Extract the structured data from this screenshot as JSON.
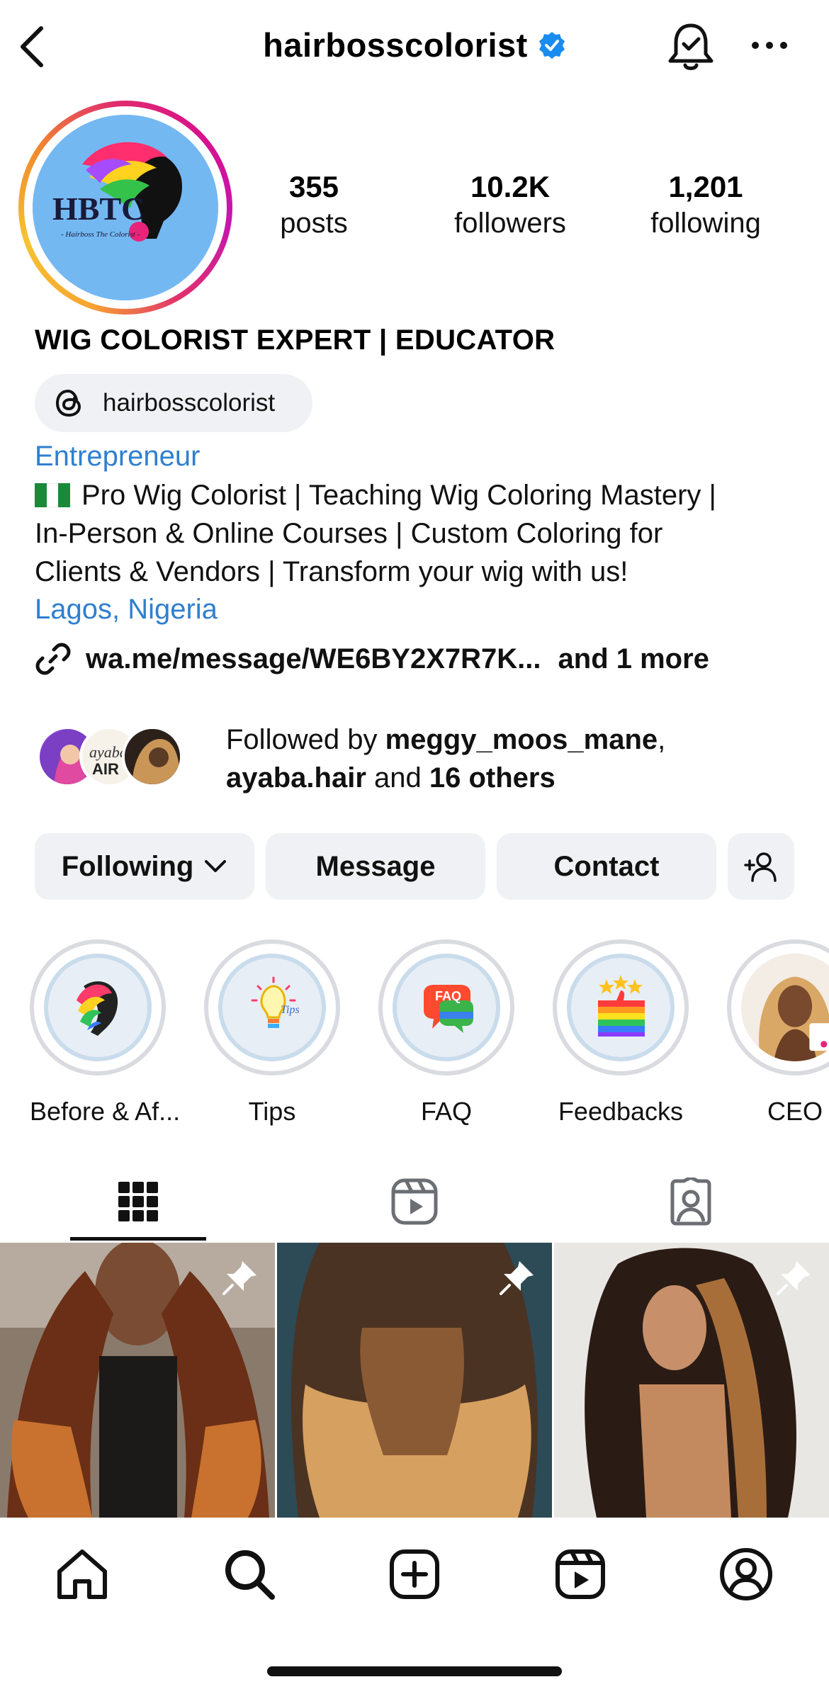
{
  "header": {
    "username": "hairbosscolorist",
    "back_icon": "chevron-left-icon",
    "notification_icon": "bell-check-icon",
    "more_icon": "ellipsis-icon"
  },
  "profile": {
    "avatar_text": "HBTC",
    "avatar_subtext": "- Hairboss The Colorist -",
    "stats": {
      "posts": {
        "value": "355",
        "label": "posts"
      },
      "followers": {
        "value": "10.2K",
        "label": "followers"
      },
      "following": {
        "value": "1,201",
        "label": "following"
      }
    },
    "name": "WIG COLORIST EXPERT | EDUCATOR",
    "threads_handle": "hairbosscolorist",
    "category": "Entrepreneur",
    "bio_lines": [
      "Pro Wig Colorist | Teaching Wig Coloring Mastery |",
      "In-Person & Online Courses | Custom Coloring for",
      "Clients & Vendors | Transform your wig with us!"
    ],
    "location": "Lagos, Nigeria",
    "link": "wa.me/message/WE6BY2X7R7K...",
    "link_more": "and 1 more",
    "followed_by": {
      "prefix": "Followed by ",
      "user1": "meggy_moos_mane",
      "sep": ",",
      "user2": "ayaba.hair",
      "and": " and ",
      "others": "16 others"
    }
  },
  "actions": {
    "following": "Following",
    "message": "Message",
    "contact": "Contact"
  },
  "highlights": [
    {
      "label": "Before & Af..."
    },
    {
      "label": "Tips",
      "badge": "Tips"
    },
    {
      "label": "FAQ",
      "badge": "FAQ"
    },
    {
      "label": "Feedbacks"
    },
    {
      "label": "CEO"
    }
  ],
  "tabs": [
    "grid-icon",
    "reels-icon",
    "tagged-icon"
  ],
  "bottom_nav": [
    "home-icon",
    "search-icon",
    "create-icon",
    "reels-icon",
    "profile-icon"
  ],
  "colors": {
    "link_blue": "#2f7fd0",
    "verified_blue": "#1a8cf0",
    "button_bg": "#eff1f4"
  }
}
